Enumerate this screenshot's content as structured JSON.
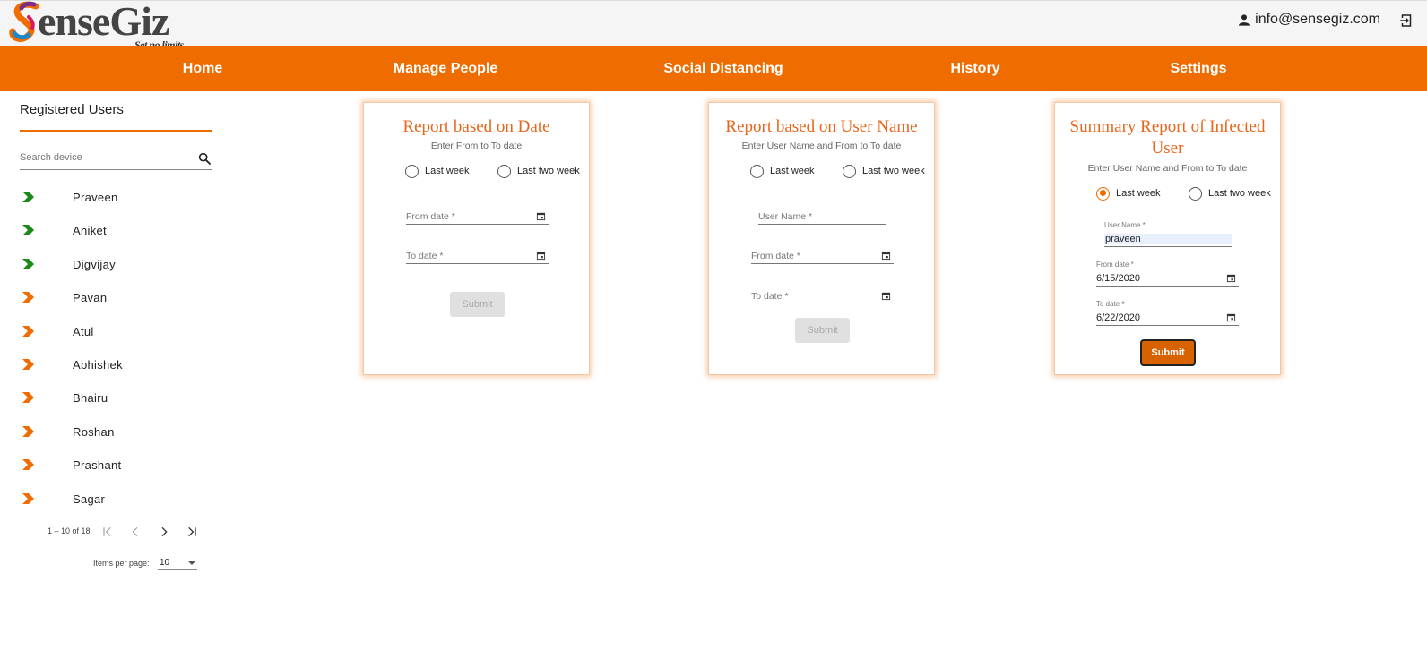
{
  "header": {
    "brand": "SenseGiz",
    "tagline": "Set no limits.",
    "user_email": "info@sensegiz.com",
    "icons": {
      "user": "person-icon",
      "logout": "logout-icon"
    }
  },
  "nav": {
    "items": [
      {
        "label": "Home"
      },
      {
        "label": "Manage People"
      },
      {
        "label": "Social Distancing"
      },
      {
        "label": "History"
      },
      {
        "label": "Settings"
      }
    ]
  },
  "sidebar": {
    "title": "Registered Users",
    "search_placeholder": "Search device",
    "users": [
      {
        "name": "Praveen",
        "status_color": "#1b8a1b"
      },
      {
        "name": "Aniket",
        "status_color": "#1b8a1b"
      },
      {
        "name": "Digvijay",
        "status_color": "#1b8a1b"
      },
      {
        "name": "Pavan",
        "status_color": "#ef6c00"
      },
      {
        "name": "Atul",
        "status_color": "#ef6c00"
      },
      {
        "name": "Abhishek",
        "status_color": "#ef6c00"
      },
      {
        "name": "Bhairu",
        "status_color": "#ef6c00"
      },
      {
        "name": "Roshan",
        "status_color": "#ef6c00"
      },
      {
        "name": "Prashant",
        "status_color": "#ef6c00"
      },
      {
        "name": "Sagar",
        "status_color": "#ef6c00"
      }
    ],
    "pagination": {
      "range": "1 – 10 of 18",
      "items_per_page_label": "Items per page:",
      "items_per_page": "10"
    }
  },
  "cards": {
    "date_report": {
      "title": "Report based on Date",
      "subtitle": "Enter From to To date",
      "radio_last_week": "Last week",
      "radio_last_two_week": "Last two week",
      "from_placeholder": "From date *",
      "to_placeholder": "To date *",
      "submit": "Submit"
    },
    "user_report": {
      "title": "Report based on User Name",
      "subtitle": "Enter User Name and From to To date",
      "radio_last_week": "Last week",
      "radio_last_two_week": "Last two week",
      "user_placeholder": "User Name *",
      "from_placeholder": "From date *",
      "to_placeholder": "To date *",
      "submit": "Submit"
    },
    "infected_report": {
      "title_line1": "Summary Report of Infected",
      "title_line2": "User",
      "subtitle": "Enter User Name and From to To date",
      "radio_last_week": "Last week",
      "radio_last_two_week": "Last two week",
      "selected_radio": "Last week",
      "user_label": "User Name *",
      "user_value": "praveen",
      "from_label": "From date *",
      "from_value": "6/15/2020",
      "to_label": "To date *",
      "to_value": "6/22/2020",
      "submit": "Submit"
    }
  },
  "colors": {
    "accent": "#ef6c00",
    "title_orange": "#e8651a",
    "online_green": "#1b8a1b"
  }
}
